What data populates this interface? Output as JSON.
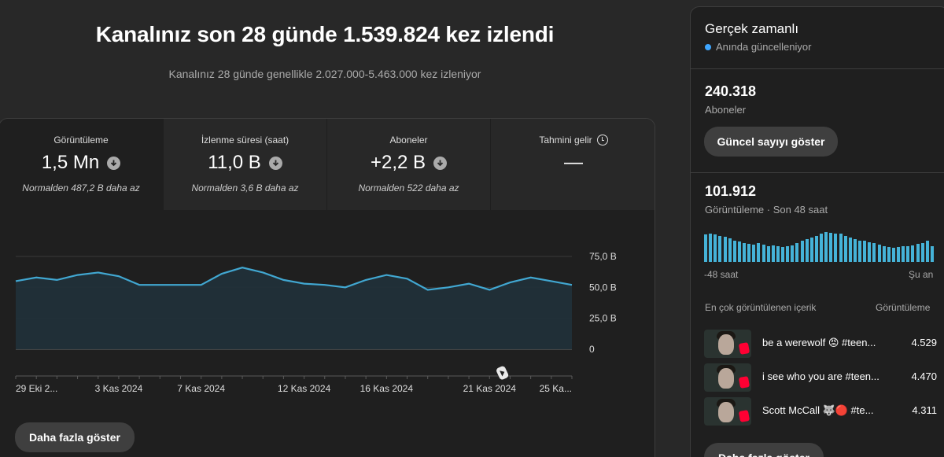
{
  "header": {
    "title": "Kanalınız son 28 günde 1.539.824 kez izlendi",
    "subtitle": "Kanalınız 28 günde genellikle 2.027.000-5.463.000 kez izleniyor"
  },
  "metrics": [
    {
      "label": "Görüntüleme",
      "value": "1,5 Mn",
      "sub": "Normalden 487,2 B daha az",
      "icon": "arrow-down-circle-icon"
    },
    {
      "label": "İzlenme süresi (saat)",
      "value": "11,0 B",
      "sub": "Normalden 3,6 B daha az",
      "icon": "arrow-down-circle-icon"
    },
    {
      "label": "Aboneler",
      "value": "+2,2 B",
      "sub": "Normalden 522 daha az",
      "icon": "arrow-down-circle-icon"
    },
    {
      "label": "Tahmini gelir",
      "value": "—",
      "sub": "",
      "icon": "clock-icon"
    }
  ],
  "chart_data": {
    "type": "area",
    "x": [
      "29 Eki 2024",
      "30 Eki 2024",
      "31 Eki 2024",
      "1 Kas 2024",
      "2 Kas 2024",
      "3 Kas 2024",
      "4 Kas 2024",
      "5 Kas 2024",
      "6 Kas 2024",
      "7 Kas 2024",
      "8 Kas 2024",
      "9 Kas 2024",
      "10 Kas 2024",
      "11 Kas 2024",
      "12 Kas 2024",
      "13 Kas 2024",
      "14 Kas 2024",
      "15 Kas 2024",
      "16 Kas 2024",
      "17 Kas 2024",
      "18 Kas 2024",
      "19 Kas 2024",
      "20 Kas 2024",
      "21 Kas 2024",
      "22 Kas 2024",
      "23 Kas 2024",
      "24 Kas 2024",
      "25 Kas 2024"
    ],
    "series": [
      {
        "values": [
          55,
          58,
          56,
          60,
          62,
          59,
          52,
          52,
          52,
          52,
          61,
          66,
          62,
          56,
          53,
          52,
          50,
          56,
          60,
          57,
          48,
          50,
          53,
          48,
          54,
          58,
          55,
          52
        ]
      }
    ],
    "xtick_labels": [
      "29 Eki 2...",
      "3 Kas 2024",
      "7 Kas 2024",
      "12 Kas 2024",
      "16 Kas 2024",
      "21 Kas 2024",
      "25 Ka..."
    ],
    "xtick_index": [
      0,
      5,
      9,
      14,
      18,
      23,
      27
    ],
    "ytick_labels": [
      "75,0 B",
      "50,0 B",
      "25,0 B",
      "0"
    ],
    "ytick_values": [
      75,
      50,
      25,
      0
    ],
    "ylim": [
      0,
      75
    ],
    "unit": "B",
    "line_color": "#41a7d1",
    "fill_color": "#213039",
    "grid": true,
    "marker_icon": "shorts-icon"
  },
  "show_more_label": "Daha fazla göster",
  "realtime": {
    "title": "Gerçek zamanlı",
    "live_label": "Anında güncelleniyor",
    "subscribers_value": "240.318",
    "subscribers_label": "Aboneler",
    "show_count_button": "Güncel sayıyı göster",
    "views_value": "101.912",
    "views_label": "Görüntüleme · Son 48 saat",
    "axis_start": "-48 saat",
    "axis_end": "Şu an",
    "hourly_views_relative": [
      0.92,
      0.96,
      0.92,
      0.88,
      0.84,
      0.8,
      0.72,
      0.68,
      0.64,
      0.6,
      0.58,
      0.62,
      0.58,
      0.54,
      0.56,
      0.54,
      0.5,
      0.52,
      0.56,
      0.62,
      0.7,
      0.76,
      0.82,
      0.88,
      0.94,
      1.0,
      0.98,
      0.96,
      0.94,
      0.88,
      0.82,
      0.76,
      0.72,
      0.7,
      0.66,
      0.62,
      0.58,
      0.54,
      0.5,
      0.48,
      0.5,
      0.52,
      0.54,
      0.56,
      0.6,
      0.64,
      0.7,
      0.52
    ],
    "top_content_header": "En çok görüntülenen içerik",
    "top_content_col": "Görüntüleme",
    "videos": [
      {
        "title": "be a werewolf 😡 #teen...",
        "views": "4.529"
      },
      {
        "title": "i see who you are #teen...",
        "views": "4.470"
      },
      {
        "title": "Scott McCall 🐺🔴 #te...",
        "views": "4.311"
      }
    ],
    "show_more_label": "Daha fazla göster",
    "accent_color": "#3ea6ff",
    "bar_color": "#45b3d8"
  }
}
